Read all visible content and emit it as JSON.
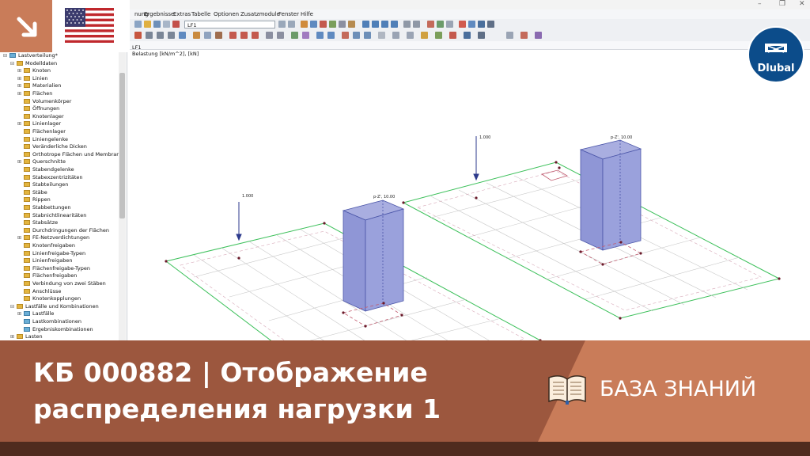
{
  "menu": [
    "nung",
    "Ergebnisse",
    "Extras",
    "Tabelle",
    "Optionen",
    "Zusatzmodule",
    "Fenster",
    "Hilfe"
  ],
  "loadcase_selector": "LF1",
  "navigator": {
    "root": "Lastverteilung*",
    "model_data": "Modelldaten",
    "items": [
      "Knoten",
      "Linien",
      "Materialien",
      "Flächen",
      "Volumenkörper",
      "Öffnungen",
      "Knotenlager",
      "Linienlager",
      "Flächenlager",
      "Liniengelenke",
      "Veränderliche Dicken",
      "Orthotrope Flächen und Membranen",
      "Querschnitte",
      "Stabendgelenke",
      "Stabexzentrizitäten",
      "Stabteilungen",
      "Stäbe",
      "Rippen",
      "Stabbettungen",
      "Stabnichtlinearitäten",
      "Stabsätze",
      "Durchdringungen der Flächen",
      "FE-Netzverdichtungen",
      "Knotenfreigaben",
      "Linienfreigabe-Typen",
      "Linienfreigaben",
      "Flächenfreigabe-Typen",
      "Flächenfreigaben",
      "Verbindung von zwei Stäben",
      "Anschlüsse",
      "Knotenkopplungen"
    ],
    "lc_group": "Lastfälle und Kombinationen",
    "lc_items": [
      "Lastfälle",
      "Lastkombinationen",
      "Ergebniskombinationen"
    ],
    "loads": "Lasten"
  },
  "viewport": {
    "lc": "LF1",
    "subtitle": "Belastung [kN/m^2], [kN]",
    "load_label_1": "1.000",
    "load_label_2": "1.000",
    "block_label_1": "p-Z', 10.00",
    "block_label_2": "p-Z', 10.00"
  },
  "banner": {
    "title": "КБ 000882 | Отображение распределения нагрузки 1",
    "kb_label": "БАЗА ЗНАНИЙ"
  },
  "brand": {
    "name": "Dlubal",
    "accent": "#c97c59",
    "dark": "#9c573e",
    "logo_blue": "#0c4c8a"
  }
}
